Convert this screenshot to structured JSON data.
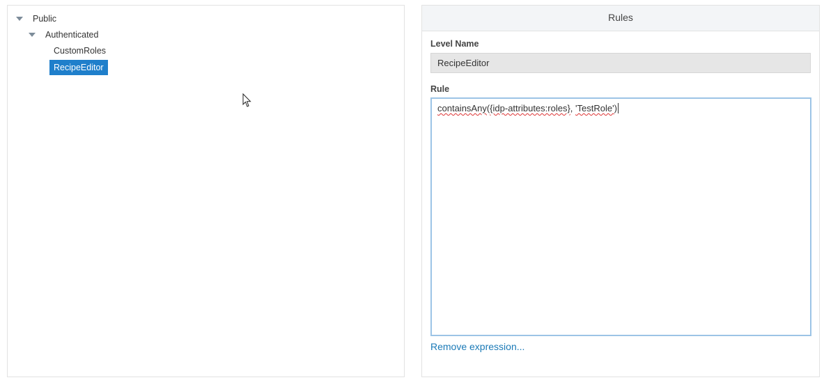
{
  "tree": {
    "items": [
      {
        "label": "Public",
        "expanded": true,
        "level": 0
      },
      {
        "label": "Authenticated",
        "expanded": true,
        "level": 1
      },
      {
        "label": "CustomRoles",
        "level": 2
      },
      {
        "label": "RecipeEditor",
        "level": 2,
        "selected": true
      }
    ]
  },
  "rules": {
    "title": "Rules",
    "level_name_label": "Level Name",
    "level_name_value": "RecipeEditor",
    "rule_label": "Rule",
    "rule_parts": {
      "p1": "containsAny",
      "p2": "(",
      "p3": "{idp-attributes:roles}",
      "p4": ", ",
      "p5": "'TestRole'",
      "p6": ")"
    },
    "remove_link": "Remove expression..."
  },
  "colors": {
    "selection": "#1f7fcb",
    "link": "#1b7ab7",
    "textarea_focus_border": "#9cc4e6"
  }
}
